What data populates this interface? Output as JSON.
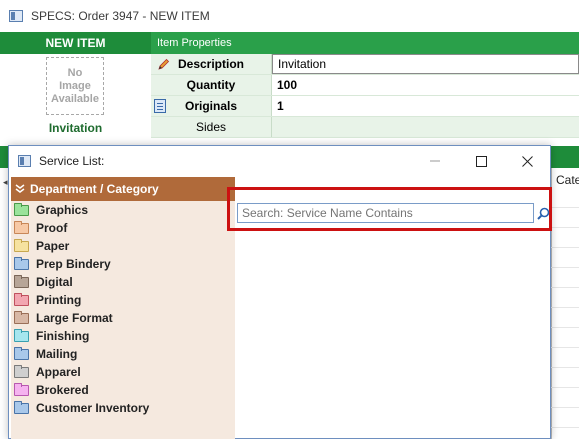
{
  "window": {
    "title": "SPECS: Order 3947 - NEW ITEM"
  },
  "left_panel": {
    "header": "NEW ITEM",
    "no_image_text": [
      "No",
      "Image",
      "Available"
    ],
    "item_name": "Invitation"
  },
  "properties": {
    "header": "Item Properties",
    "rows": [
      {
        "label": "Description",
        "value": "Invitation",
        "icon": "pencil-icon"
      },
      {
        "label": "Quantity",
        "value": "100"
      },
      {
        "label": "Originals",
        "value": "1",
        "icon": "originals-icon"
      },
      {
        "label": "Sides",
        "value": ""
      }
    ]
  },
  "background_grid": {
    "column_header": "Cate"
  },
  "dialog": {
    "title": "Service List:",
    "controls": {
      "minimize": "—",
      "maximize": "☐",
      "close": "✕"
    },
    "tree_header": "Department / Category",
    "tree_header_icon": "double-chevron-down-icon",
    "categories": [
      {
        "label": "Graphics",
        "color": "#9be39b",
        "border": "#4a9a4a"
      },
      {
        "label": "Proof",
        "color": "#f7c9a6",
        "border": "#c88758"
      },
      {
        "label": "Paper",
        "color": "#f6e2a0",
        "border": "#c8a850"
      },
      {
        "label": "Prep Bindery",
        "color": "#a9c8ea",
        "border": "#4a74a8"
      },
      {
        "label": "Digital",
        "color": "#b7a597",
        "border": "#7a6658"
      },
      {
        "label": "Printing",
        "color": "#f2a6b0",
        "border": "#c0505e"
      },
      {
        "label": "Large Format",
        "color": "#d8b8a6",
        "border": "#9a6f58"
      },
      {
        "label": "Finishing",
        "color": "#a6e6ee",
        "border": "#3aa0b0"
      },
      {
        "label": "Mailing",
        "color": "#a9c8ea",
        "border": "#4a74a8"
      },
      {
        "label": "Apparel",
        "color": "#cfcfcf",
        "border": "#7a7a7a"
      },
      {
        "label": "Brokered",
        "color": "#f5b3ef",
        "border": "#b858b0"
      },
      {
        "label": "Customer Inventory",
        "color": "#a9c8ea",
        "border": "#4a74a8"
      }
    ],
    "search": {
      "placeholder": "Search: Service Name Contains",
      "button_icon": "search-icon"
    }
  },
  "colors": {
    "green_dark": "#1e8c3a",
    "green_light": "#2aa04a",
    "category_header": "#b06a3a",
    "tree_bg": "#f5e9df",
    "highlight_red": "#cc1111"
  }
}
